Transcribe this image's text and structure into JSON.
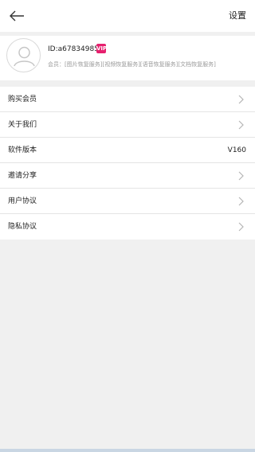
{
  "header": {
    "back_icon": "arrow-left-icon",
    "title": "设置"
  },
  "profile": {
    "avatar_icon": "user-avatar-icon",
    "user_id": "ID:a678349857",
    "vip_badge": "VIP",
    "membership_text": "会员：[图片恢复服务][视频恢复服务][语音恢复服务][文档恢复服务]"
  },
  "menu": {
    "items": [
      {
        "label": "购买会员",
        "icon": "chevron-right-icon"
      },
      {
        "label": "关于我们",
        "icon": "chevron-right-icon"
      },
      {
        "label": "软件版本",
        "value": "V160"
      },
      {
        "label": "邀请分享",
        "icon": "chevron-right-icon"
      },
      {
        "label": "用户协议",
        "icon": "chevron-right-icon"
      },
      {
        "label": "隐私协议",
        "icon": "chevron-right-icon"
      }
    ]
  },
  "colors": {
    "background": "#f0f0f0",
    "surface": "#ffffff",
    "vip_accent": "#e6206e",
    "muted_text": "#9a9a9a",
    "chevron": "#b5b5b5"
  }
}
